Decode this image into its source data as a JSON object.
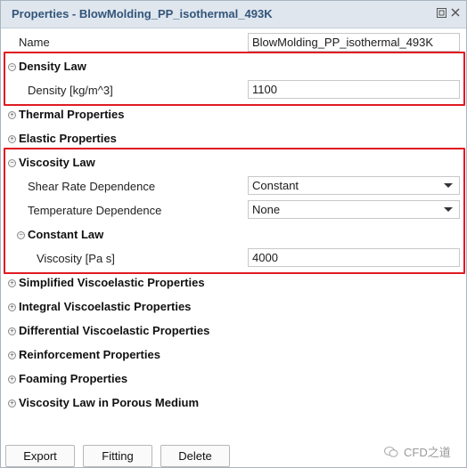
{
  "panel": {
    "title": "Properties - BlowMolding_PP_isothermal_493K"
  },
  "name_row": {
    "label": "Name",
    "value": "BlowMolding_PP_isothermal_493K"
  },
  "density_law": {
    "title": "Density Law",
    "expanded": true,
    "density": {
      "label": "Density [kg/m^3]",
      "value": "1100"
    }
  },
  "sections_collapsed_1": [
    {
      "title": "Thermal Properties"
    },
    {
      "title": "Elastic Properties"
    }
  ],
  "viscosity_law": {
    "title": "Viscosity Law",
    "expanded": true,
    "shear_rate": {
      "label": "Shear Rate Dependence",
      "value": "Constant"
    },
    "temperature": {
      "label": "Temperature Dependence",
      "value": "None"
    },
    "constant_law": {
      "title": "Constant Law",
      "viscosity": {
        "label": "Viscosity [Pa s]",
        "value": "4000"
      }
    }
  },
  "sections_collapsed_2": [
    {
      "title": "Simplified Viscoelastic Properties"
    },
    {
      "title": "Integral Viscoelastic Properties"
    },
    {
      "title": "Differential Viscoelastic Properties"
    },
    {
      "title": "Reinforcement Properties"
    },
    {
      "title": "Foaming Properties"
    },
    {
      "title": "Viscosity Law in Porous Medium"
    }
  ],
  "buttons": {
    "export": "Export",
    "fitting": "Fitting",
    "delete": "Delete"
  },
  "watermark": {
    "text": "CFD之道"
  },
  "colors": {
    "highlight": "#e01a22",
    "title_text": "#33557a",
    "title_bg": "#dfe6ee"
  },
  "icons": {
    "expanded": "circle-minus-icon",
    "collapsed": "circle-plus-icon"
  }
}
